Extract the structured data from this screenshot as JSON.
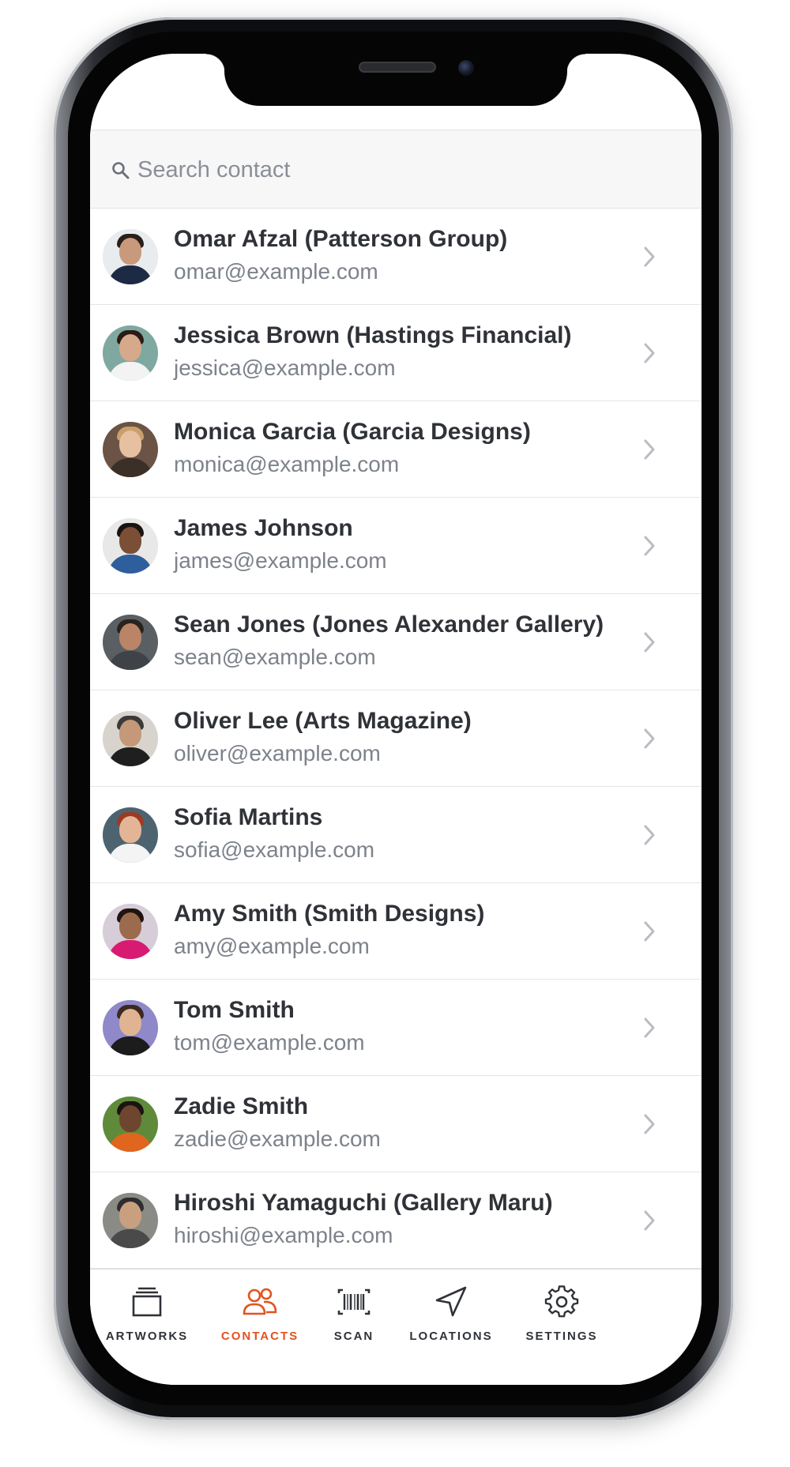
{
  "search": {
    "placeholder": "Search contact",
    "value": ""
  },
  "contacts": [
    {
      "name": "Omar Afzal (Patterson Group)",
      "email": "omar@example.com"
    },
    {
      "name": "Jessica Brown (Hastings Financial)",
      "email": "jessica@example.com"
    },
    {
      "name": "Monica Garcia (Garcia Designs)",
      "email": "monica@example.com"
    },
    {
      "name": "James Johnson",
      "email": "james@example.com"
    },
    {
      "name": "Sean Jones (Jones Alexander Gallery)",
      "email": "sean@example.com"
    },
    {
      "name": "Oliver Lee (Arts Magazine)",
      "email": "oliver@example.com"
    },
    {
      "name": "Sofia Martins",
      "email": "sofia@example.com"
    },
    {
      "name": "Amy Smith (Smith Designs)",
      "email": "amy@example.com"
    },
    {
      "name": "Tom Smith",
      "email": "tom@example.com"
    },
    {
      "name": "Zadie Smith",
      "email": "zadie@example.com"
    },
    {
      "name": "Hiroshi Yamaguchi (Gallery Maru)",
      "email": "hiroshi@example.com"
    }
  ],
  "tabs": [
    {
      "label": "ARTWORKS",
      "icon": "artworks-icon",
      "active": false
    },
    {
      "label": "CONTACTS",
      "icon": "contacts-icon",
      "active": true
    },
    {
      "label": "SCAN",
      "icon": "barcode-icon",
      "active": false
    },
    {
      "label": "LOCATIONS",
      "icon": "navigation-arrow-icon",
      "active": false
    },
    {
      "label": "SETTINGS",
      "icon": "gear-icon",
      "active": false
    }
  ],
  "colors": {
    "accent": "#e2531f",
    "text": "#2f3237",
    "muted": "#7d828b",
    "chevron": "#b9bcc2"
  }
}
